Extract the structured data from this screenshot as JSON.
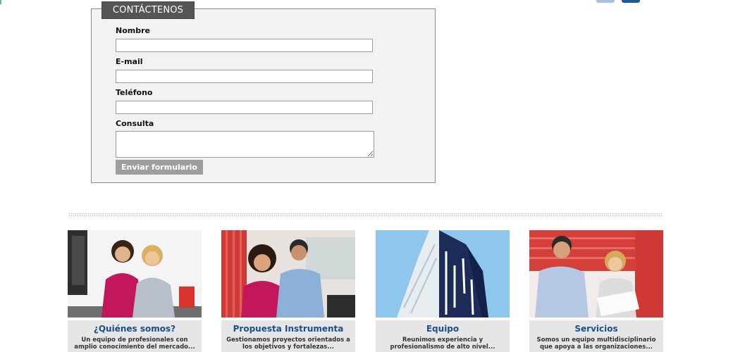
{
  "contact": {
    "tab_label": "CONTÁCTENOS",
    "fields": [
      {
        "label": "Nombre",
        "value": ""
      },
      {
        "label": "E-mail",
        "value": ""
      },
      {
        "label": "Teléfono",
        "value": ""
      },
      {
        "label": "Consulta",
        "value": ""
      }
    ],
    "submit_label": "Enviar formulario"
  },
  "cards": [
    {
      "title": "¿Quiénes somos?",
      "desc": "Un equipo de profesionales con amplio conocimiento del mercado..."
    },
    {
      "title": "Propuesta Instrumenta",
      "desc": "Gestionamos proyectos orientados a los objetivos y fortalezas..."
    },
    {
      "title": "Equipo",
      "desc": "Reunimos experiencia y profesionalismo de alto nivel..."
    },
    {
      "title": "Servicios",
      "desc": "Somos un equipo multidisciplinario que apoya a las organizaciones..."
    }
  ],
  "colors": {
    "accent": "#1a4f8c",
    "tab_bg": "#555555",
    "button_bg": "#9e9e9e",
    "panel_bg": "#f2f2f2"
  },
  "icons": [
    "facebook-icon",
    "linkedin-icon"
  ]
}
